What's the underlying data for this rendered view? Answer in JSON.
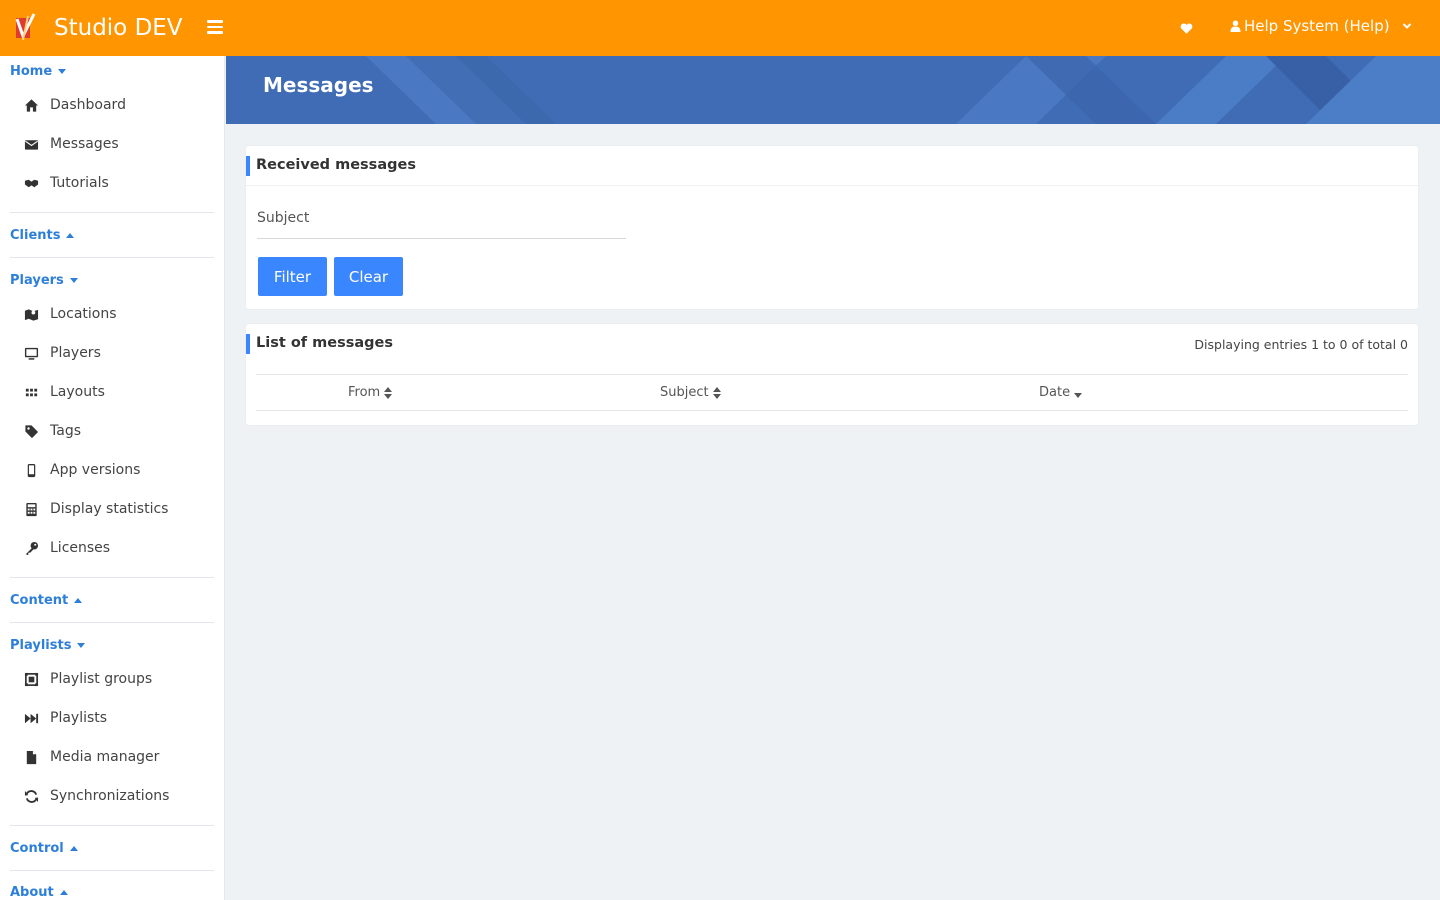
{
  "app": {
    "title": "Studio DEV",
    "accent_color": "#ff9500",
    "link_color": "#2d7fd9",
    "button_color": "#3a86ff"
  },
  "topbar": {
    "user_label": "Help System (Help)",
    "icons": [
      "logo-icon",
      "hamburger-icon",
      "heart-icon",
      "user-icon",
      "chevron-down-icon"
    ]
  },
  "sidebar": {
    "home": {
      "label": "Home",
      "expanded": true
    },
    "home_items": [
      {
        "label": "Dashboard",
        "icon": "home-icon"
      },
      {
        "label": "Messages",
        "icon": "envelope-icon"
      },
      {
        "label": "Tutorials",
        "icon": "handshake-icon"
      }
    ],
    "clients": {
      "label": "Clients",
      "expanded": false
    },
    "players": {
      "label": "Players",
      "expanded": true
    },
    "players_items": [
      {
        "label": "Locations",
        "icon": "map-icon"
      },
      {
        "label": "Players",
        "icon": "monitor-icon"
      },
      {
        "label": "Layouts",
        "icon": "grid-icon"
      },
      {
        "label": "Tags",
        "icon": "tag-icon"
      },
      {
        "label": "App versions",
        "icon": "mobile-icon"
      },
      {
        "label": "Display statistics",
        "icon": "calculator-icon"
      },
      {
        "label": "Licenses",
        "icon": "key-icon"
      }
    ],
    "content": {
      "label": "Content",
      "expanded": false
    },
    "playlists": {
      "label": "Playlists",
      "expanded": true
    },
    "playlists_items": [
      {
        "label": "Playlist groups",
        "icon": "object-group-icon"
      },
      {
        "label": "Playlists",
        "icon": "fast-forward-icon"
      },
      {
        "label": "Media manager",
        "icon": "file-icon"
      },
      {
        "label": "Synchronizations",
        "icon": "sync-icon"
      }
    ],
    "control": {
      "label": "Control",
      "expanded": false
    },
    "about": {
      "label": "About",
      "expanded": false
    }
  },
  "page": {
    "title": "Messages"
  },
  "filter_panel": {
    "title": "Received messages",
    "subject_label": "Subject",
    "subject_value": "",
    "filter_button": "Filter",
    "clear_button": "Clear"
  },
  "list_panel": {
    "title": "List of messages",
    "count_text": "Displaying entries 1 to 0 of total 0",
    "columns": [
      {
        "label": "From",
        "sort": "both"
      },
      {
        "label": "Subject",
        "sort": "both"
      },
      {
        "label": "Date",
        "sort": "desc"
      }
    ],
    "rows": []
  }
}
